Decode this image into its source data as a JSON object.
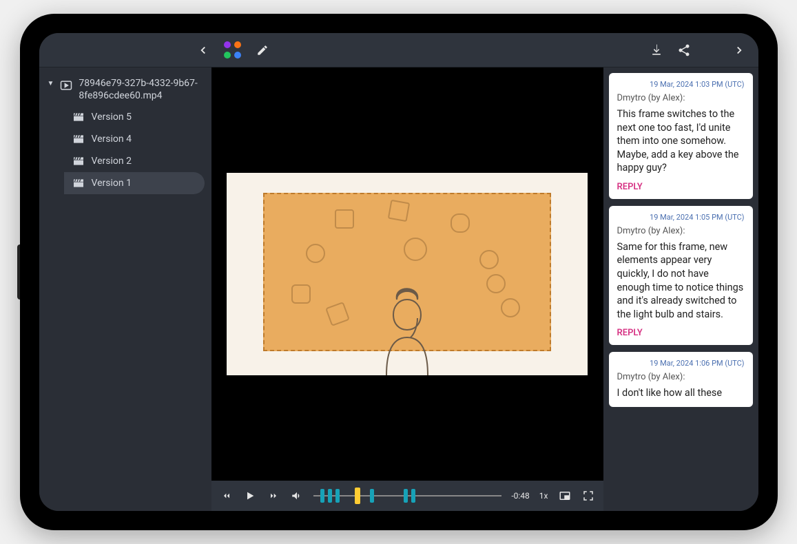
{
  "topbar": {
    "back_icon": "chevron-left",
    "edit_icon": "pencil",
    "download_icon": "download",
    "share_icon": "share",
    "collapse_icon": "chevron-right"
  },
  "sidebar": {
    "file_name": "78946e79-327b-4332-9b67-8fe896cdee60.mp4",
    "versions": [
      {
        "label": "Version 5",
        "active": false
      },
      {
        "label": "Version 4",
        "active": false
      },
      {
        "label": "Version 2",
        "active": false
      },
      {
        "label": "Version 1",
        "active": true
      }
    ]
  },
  "player": {
    "time_remaining": "-0:48",
    "speed": "1x",
    "markers_pct": [
      4,
      8,
      12,
      24,
      30,
      48,
      52
    ],
    "playhead_pct": 22
  },
  "comments": [
    {
      "timestamp": "19 Mar, 2024 1:03 PM (UTC)",
      "author": "Dmytro (by Alex):",
      "body": "This frame switches to the next one too fast, I'd unite them into one somehow. Maybe, add a key above the happy guy?",
      "reply_label": "REPLY"
    },
    {
      "timestamp": "19 Mar, 2024 1:05 PM (UTC)",
      "author": "Dmytro (by Alex):",
      "body": "Same for this frame, new elements appear very quickly, I do not have enough time to notice things and it's already switched to the light bulb and stairs.",
      "reply_label": "REPLY"
    },
    {
      "timestamp": "19 Mar, 2024 1:06 PM (UTC)",
      "author": "Dmytro (by Alex):",
      "body": "I don't like how all these",
      "reply_label": "REPLY"
    }
  ]
}
